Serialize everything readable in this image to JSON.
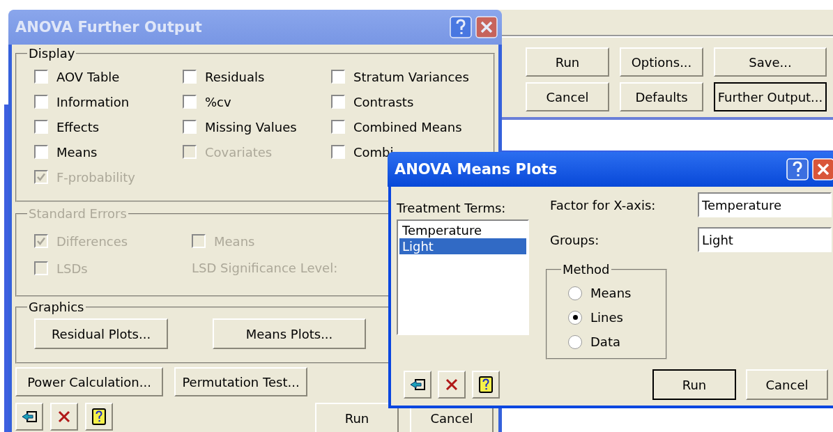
{
  "main_window": {
    "buttons": [
      {
        "label": "Run",
        "default": false
      },
      {
        "label": "Options...",
        "default": false
      },
      {
        "label": "Save...",
        "default": false
      },
      {
        "label": "Cancel",
        "default": false
      },
      {
        "label": "Defaults",
        "default": false
      },
      {
        "label": "Further Output...",
        "default": true
      }
    ]
  },
  "further_output": {
    "title": "ANOVA Further Output",
    "active": false,
    "display": {
      "label": "Display",
      "disabled": false,
      "items": [
        {
          "label": "AOV Table",
          "checked": false,
          "disabled": false
        },
        {
          "label": "Residuals",
          "checked": false,
          "disabled": false
        },
        {
          "label": "Stratum Variances",
          "checked": false,
          "disabled": false
        },
        {
          "label": "Information",
          "checked": false,
          "disabled": false
        },
        {
          "label": "%cv",
          "checked": false,
          "disabled": false
        },
        {
          "label": "Contrasts",
          "checked": false,
          "disabled": false
        },
        {
          "label": "Effects",
          "checked": false,
          "disabled": false
        },
        {
          "label": "Missing Values",
          "checked": false,
          "disabled": false
        },
        {
          "label": "Combined Means",
          "checked": false,
          "disabled": false
        },
        {
          "label": "Means",
          "checked": false,
          "disabled": false
        },
        {
          "label": "Covariates",
          "checked": false,
          "disabled": true
        },
        {
          "label": "Combi",
          "checked": false,
          "disabled": false
        },
        {
          "label": "F-probability",
          "checked": true,
          "disabled": true
        }
      ]
    },
    "standard_errors": {
      "label": "Standard Errors",
      "disabled": true,
      "items": [
        {
          "kind": "checkbox",
          "label": "Differences",
          "checked": true,
          "disabled": true
        },
        {
          "kind": "checkbox",
          "label": "Means",
          "checked": false,
          "disabled": true
        },
        {
          "kind": "checkbox",
          "label": "LSDs",
          "checked": false,
          "disabled": true
        },
        {
          "kind": "label",
          "label": "LSD Significance Level:",
          "disabled": true
        }
      ]
    },
    "graphics": {
      "label": "Graphics",
      "buttons": [
        "Residual Plots...",
        "Means Plots..."
      ]
    },
    "buttons": [
      "Power Calculation...",
      "Permutation Test..."
    ],
    "footer_buttons": [
      "Run",
      "Cancel"
    ]
  },
  "means_plots": {
    "title": "ANOVA Means Plots",
    "active": true,
    "treatment_terms": {
      "label": "Treatment Terms:",
      "items": [
        {
          "label": "Temperature",
          "selected": false
        },
        {
          "label": "Light",
          "selected": true
        }
      ]
    },
    "fields": [
      {
        "label": "Factor for X-axis:",
        "value": "Temperature"
      },
      {
        "label": "Groups:",
        "value": "Light"
      }
    ],
    "method": {
      "label": "Method",
      "options": [
        {
          "label": "Means",
          "selected": false
        },
        {
          "label": "Lines",
          "selected": true
        },
        {
          "label": "Data",
          "selected": false
        }
      ]
    },
    "buttons": [
      {
        "label": "Run",
        "default": true
      },
      {
        "label": "Cancel",
        "default": false
      }
    ]
  }
}
